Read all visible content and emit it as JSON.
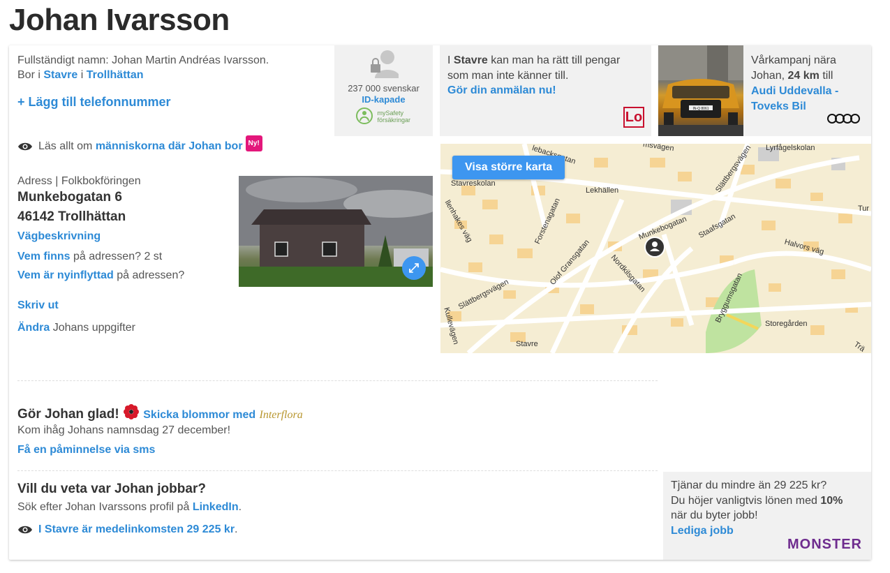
{
  "title": "Johan Ivarsson",
  "info": {
    "fullname_line": "Fullständigt namn: Johan Martin Andréas Ivarsson.",
    "lives_prefix": "Bor i",
    "lives_district": "Stavre",
    "lives_mid": "i",
    "lives_city": "Trollhättan",
    "add_phone": "+ Lägg till telefonnummer",
    "read_prefix": "Läs allt om",
    "read_link": "människorna där Johan bor",
    "new_badge": "Ny!"
  },
  "id_box": {
    "count": "237 000 svenskar",
    "link": "ID-kapade",
    "logo_line1": "mySafety",
    "logo_line2": "försäkringar"
  },
  "stavre_box": {
    "prefix": "I",
    "place": "Stavre",
    "text": "kan man ha rätt till pengar som man inte känner till.",
    "link": "Gör din anmälan nu!",
    "logo": "Lo"
  },
  "audi_box": {
    "line1": "Vårkampanj nära",
    "line2_prefix": "Johan,",
    "distance": "24 km",
    "line2_suffix": "till",
    "dealer": "Audi Uddevalla - Toveks Bil",
    "plate": "IN-Q 8061"
  },
  "address": {
    "label": "Adress | Folkbokföringen",
    "street": "Munkebogatan 6",
    "zip_city": "46142 Trollhättan",
    "directions": "Vägbeskrivning",
    "who_link": "Vem finns",
    "who_text": "på adressen? 2 st",
    "new_link": "Vem är nyinflyttad",
    "new_text": "på adressen?",
    "print": "Skriv ut",
    "edit_link": "Ändra",
    "edit_text": "Johans uppgifter"
  },
  "map": {
    "button": "Visa större karta",
    "streets": {
      "s1": "Stavreskolan",
      "s2": "Lekhällen",
      "s3": "Lyrfågelskolan",
      "s4": "Slättbergsvägen",
      "s5": "Forstenagatan",
      "s6": "Munkebogatan",
      "s7": "Staafsgatan",
      "s8": "Halvors väg",
      "s9": "Olof Gransgatan",
      "s10": "Nordkilsgatan",
      "s11": "Slättbergsvägen",
      "s12": "Bryggumsgatan",
      "s13": "Storegården",
      "s14": "Stavre",
      "s15": "Kullevägen",
      "s16": "Tur",
      "s17": "lebacksgatan",
      "s18": "msvägen",
      "s19": "llenhakes väg",
      "s20": "Trä"
    }
  },
  "flowers": {
    "heading": "Gör Johan glad!",
    "link": "Skicka blommor med",
    "brand": "Interflora",
    "nameday": "Kom ihåg Johans namnsdag 27 december!",
    "sms": "Få en påminnelse via sms"
  },
  "job": {
    "heading": "Vill du veta var Johan jobbar?",
    "search_prefix": "Sök efter Johan Ivarssons profil på",
    "linkedin": "LinkedIn",
    "search_suffix": ".",
    "income_link": "I Stavre är medelinkomsten 29 225 kr",
    "income_suffix": "."
  },
  "monster_box": {
    "line1": "Tjänar du mindre än 29 225 kr?",
    "line2_prefix": "Du höjer vanligtvis lönen med",
    "percent": "10%",
    "line3": "när du byter jobb!",
    "link": "Lediga jobb",
    "brand": "MONSTER"
  }
}
